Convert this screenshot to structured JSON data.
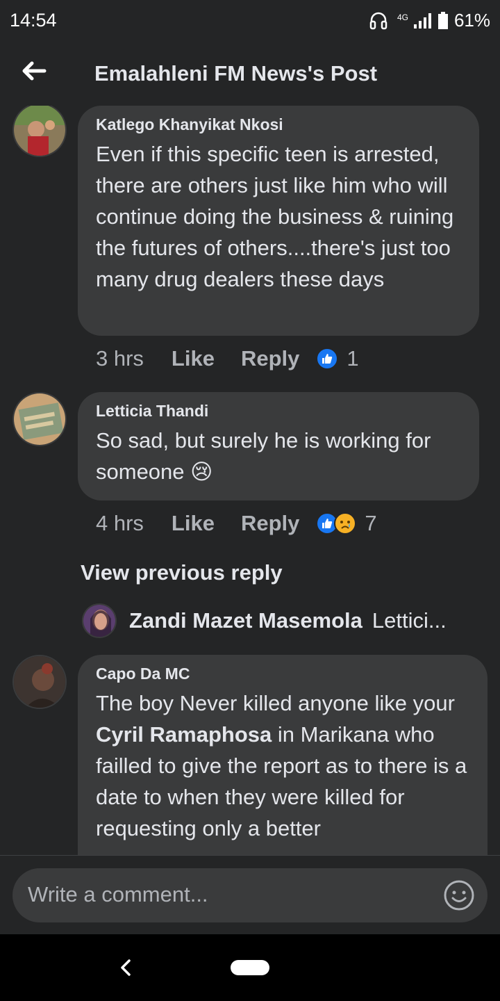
{
  "status_bar": {
    "time": "14:54",
    "network": "4G",
    "battery": "61%"
  },
  "header": {
    "title": "Emalahleni FM News's Post"
  },
  "comments": [
    {
      "author": "Katlego Khanyikat Nkosi",
      "text": "Even if this specific teen is arrested, there are others just like him who will continue doing the business & ruining the futures of others....there's just too many drug dealers these days",
      "time": "3 hrs",
      "like": "Like",
      "reply": "Reply",
      "reaction_count": "1"
    },
    {
      "author": "Letticia Thandi",
      "text": "So sad, but surely he is working for someone 😢",
      "time": "4 hrs",
      "like": "Like",
      "reply": "Reply",
      "reaction_count": "7"
    },
    {
      "author": "Capo Da MC",
      "text_before": "The boy Never killed anyone like your ",
      "mention": "Cyril Ramaphosa",
      "text_after": " in Marikana who failled to give the report as to there is a date to when they were killed for requesting only a better"
    }
  ],
  "view_previous": "View previous reply",
  "reply_preview": {
    "name": "Zandi Mazet Masemola",
    "snippet": "Lettici..."
  },
  "composer": {
    "placeholder": "Write a comment..."
  }
}
